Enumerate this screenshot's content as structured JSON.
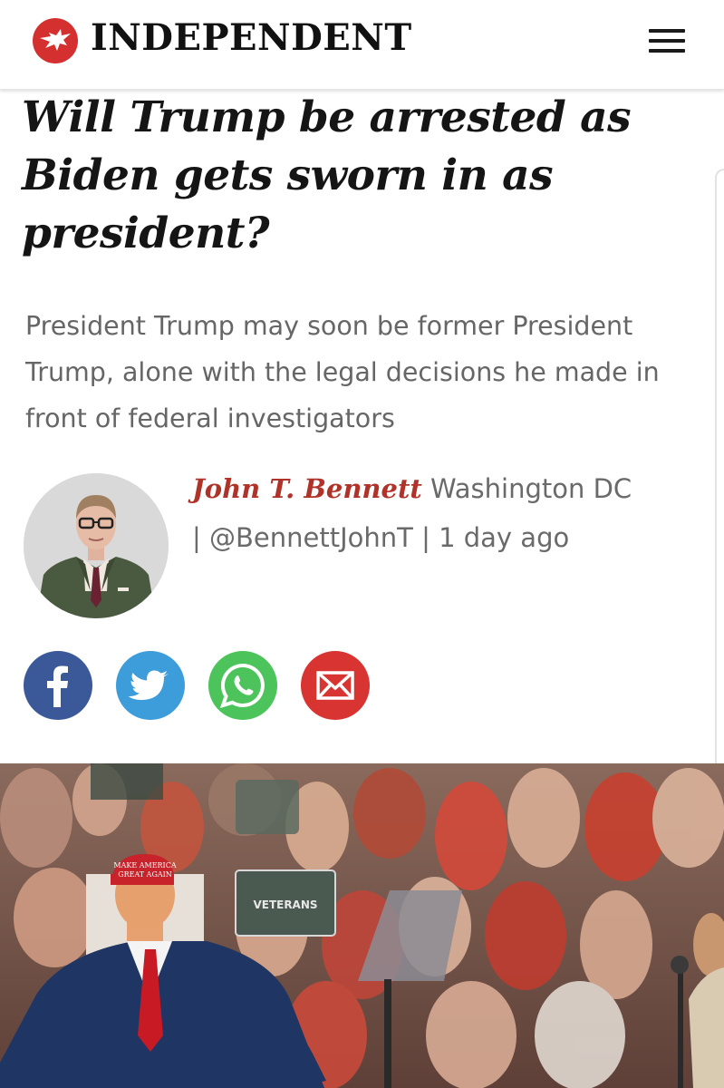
{
  "header": {
    "masthead": "INDEPENDENT",
    "logo_icon": "eagle-logo-icon",
    "menu_icon": "hamburger-menu-icon"
  },
  "article": {
    "headline": "Will Trump be arrested as Biden gets sworn in as president?",
    "standfirst": "President Trump may soon be former President Trump, alone with the legal decisions he made in front of federal investigators",
    "author": {
      "name": "John T. Bennett",
      "location": "Washington DC",
      "twitter": "@BennettJohnT",
      "time": "1 day ago"
    },
    "lead_image": {
      "hat_text_line1": "MAKE AMERICA",
      "hat_text_line2": "GREAT AGAIN",
      "sign_text": "VETERANS"
    }
  },
  "share": {
    "buttons": [
      "facebook-icon",
      "twitter-icon",
      "whatsapp-icon",
      "email-icon"
    ]
  },
  "colors": {
    "brand_red": "#d3302f",
    "author_red": "#b0332a",
    "facebook": "#3b5998",
    "twitter": "#3d9ddb",
    "whatsapp": "#4cc45b",
    "email": "#d83432"
  }
}
